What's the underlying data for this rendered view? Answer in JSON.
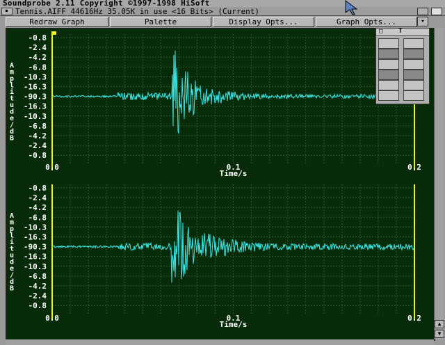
{
  "app": {
    "title": "Soundprobe 2.11 Copyright ©1997-1998 HiSoft",
    "subtitle": "Tennis.AIFF 44616Hz 35.05K in use <16 Bits> (Current)"
  },
  "toolbar": {
    "redraw_label": "Redraw Graph",
    "palette_label": "Palette",
    "display_label": "Display Opts...",
    "graph_label": "Graph Opts...",
    "small_icon": "collapse-icon"
  },
  "palette": {
    "head_left": "□",
    "head_mid": "T",
    "tools": [
      "copy-to-icon",
      "copy-from-icon",
      "play-icon",
      "stop-icon",
      "magnify-icon",
      "loop-icon",
      "zoom-in-icon",
      "zoom-out-icon",
      "cut-icon",
      "paste-icon",
      "range-icon",
      "marker-icon"
    ]
  },
  "colors": {
    "plot_bg": "#082c0a",
    "grid": "#2c5a2c",
    "wave": "#3de6e6",
    "label": "#ffffff",
    "axis_yellow": "#f0f020"
  },
  "chart_data": {
    "type": "line",
    "panels": [
      {
        "ylabel": "Amplitude/dB",
        "yticks": [
          "-0.8",
          "-2.4",
          "-4.2",
          "-6.8",
          "-10.3",
          "-16.3",
          "-90.3",
          "-16.3",
          "-10.3",
          "-6.8",
          "-4.2",
          "-2.4",
          "-0.8"
        ],
        "xticks": [
          "0.0",
          "0.1",
          "0.2"
        ],
        "xlabel": "Time/s",
        "xlim": [
          0,
          0.2
        ]
      },
      {
        "ylabel": "Amplitude/dB",
        "yticks": [
          "-0.8",
          "-2.4",
          "-4.2",
          "-6.8",
          "-10.3",
          "-16.3",
          "-90.3",
          "-16.3",
          "-10.3",
          "-6.8",
          "-4.2",
          "-2.4",
          "-0.8"
        ],
        "xticks": [
          "0.0",
          "0.1",
          "0.2"
        ],
        "xlabel": "Time/s",
        "xlim": [
          0,
          0.2
        ]
      }
    ]
  }
}
